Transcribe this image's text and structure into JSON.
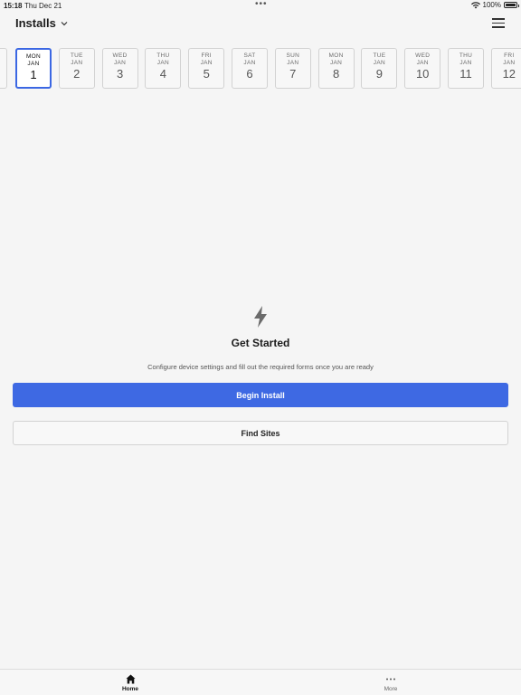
{
  "status": {
    "time": "15:18",
    "date": "Thu Dec 21",
    "battery": "100%"
  },
  "header": {
    "title": "Installs"
  },
  "date_strip": {
    "selected_index": 0,
    "dates": [
      {
        "dow": "MON",
        "month": "JAN",
        "day": "1"
      },
      {
        "dow": "TUE",
        "month": "JAN",
        "day": "2"
      },
      {
        "dow": "WED",
        "month": "JAN",
        "day": "3"
      },
      {
        "dow": "THU",
        "month": "JAN",
        "day": "4"
      },
      {
        "dow": "FRI",
        "month": "JAN",
        "day": "5"
      },
      {
        "dow": "SAT",
        "month": "JAN",
        "day": "6"
      },
      {
        "dow": "SUN",
        "month": "JAN",
        "day": "7"
      },
      {
        "dow": "MON",
        "month": "JAN",
        "day": "8"
      },
      {
        "dow": "TUE",
        "month": "JAN",
        "day": "9"
      },
      {
        "dow": "WED",
        "month": "JAN",
        "day": "10"
      },
      {
        "dow": "THU",
        "month": "JAN",
        "day": "11"
      },
      {
        "dow": "FRI",
        "month": "JAN",
        "day": "12"
      }
    ]
  },
  "empty_state": {
    "icon": "lightning-bolt-icon",
    "title": "Get Started",
    "description": "Configure device settings and fill out the required forms once you are ready"
  },
  "actions": {
    "primary_label": "Begin Install",
    "secondary_label": "Find Sites"
  },
  "tab_bar": {
    "home_label": "Home",
    "more_label": "More"
  },
  "colors": {
    "accent": "#3e69e3",
    "background": "#f5f5f5"
  }
}
